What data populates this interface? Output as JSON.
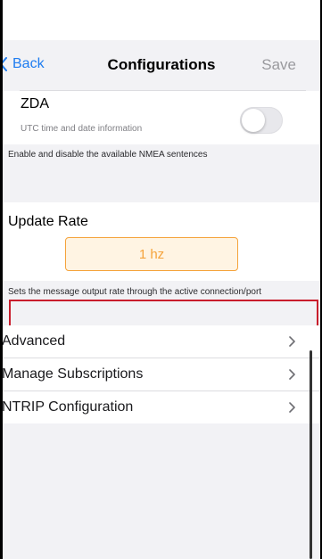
{
  "nav": {
    "back_label": "Back",
    "title": "Configurations",
    "save_label": "Save"
  },
  "zda": {
    "title": "ZDA",
    "subtitle": "UTC time and date information",
    "enabled": false
  },
  "nmea_note": "Enable and disable the available NMEA sentences",
  "update_rate": {
    "title": "Update Rate",
    "value": "1 hz",
    "note": "Sets the message output rate through the active connection/port"
  },
  "menu": [
    {
      "label": "Advanced"
    },
    {
      "label": "Manage Subscriptions"
    },
    {
      "label": "NTRIP Configuration"
    }
  ],
  "colors": {
    "accent": "#1e7cf0",
    "rate_button": "#f5a33b",
    "highlight": "#c91d2c"
  }
}
